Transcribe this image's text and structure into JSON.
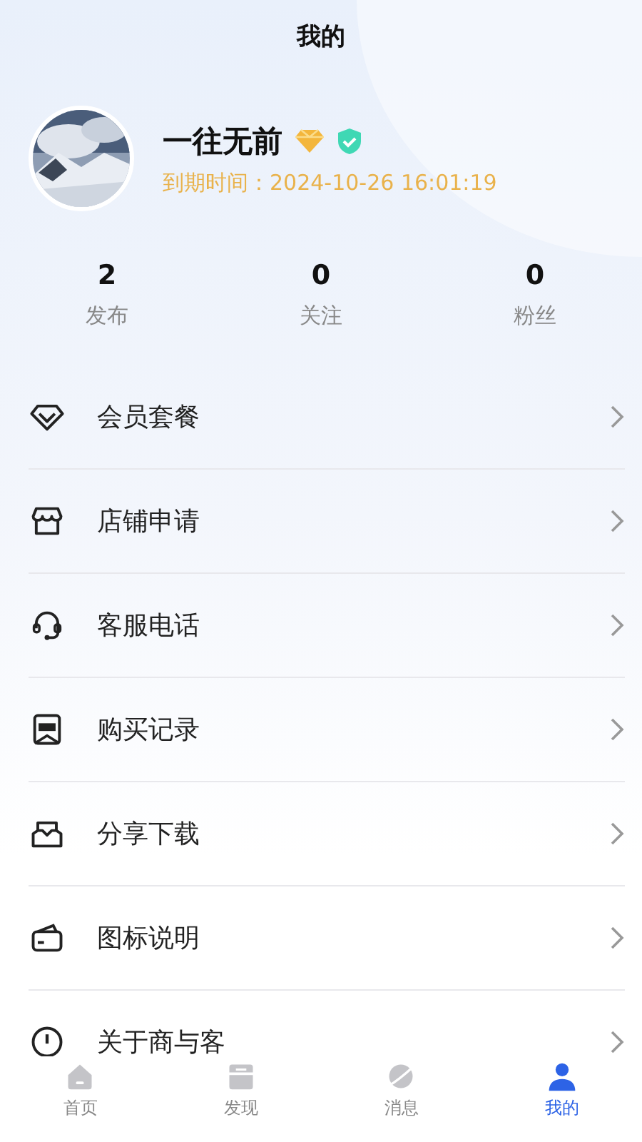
{
  "header": {
    "title": "我的"
  },
  "profile": {
    "name": "一往无前",
    "expiry_label": "到期时间：",
    "expiry": "2024-10-26 16:01:19"
  },
  "stats": [
    {
      "value": "2",
      "label": "发布"
    },
    {
      "value": "0",
      "label": "关注"
    },
    {
      "value": "0",
      "label": "粉丝"
    }
  ],
  "menu": [
    {
      "label": "会员套餐"
    },
    {
      "label": "店铺申请"
    },
    {
      "label": "客服电话"
    },
    {
      "label": "购买记录"
    },
    {
      "label": "分享下载"
    },
    {
      "label": "图标说明"
    },
    {
      "label": "关于商与客"
    }
  ],
  "tab_bar": [
    {
      "label": "首页",
      "selected": false
    },
    {
      "label": "发现",
      "selected": false
    },
    {
      "label": "消息",
      "selected": false
    },
    {
      "label": "我的",
      "selected": true
    }
  ]
}
